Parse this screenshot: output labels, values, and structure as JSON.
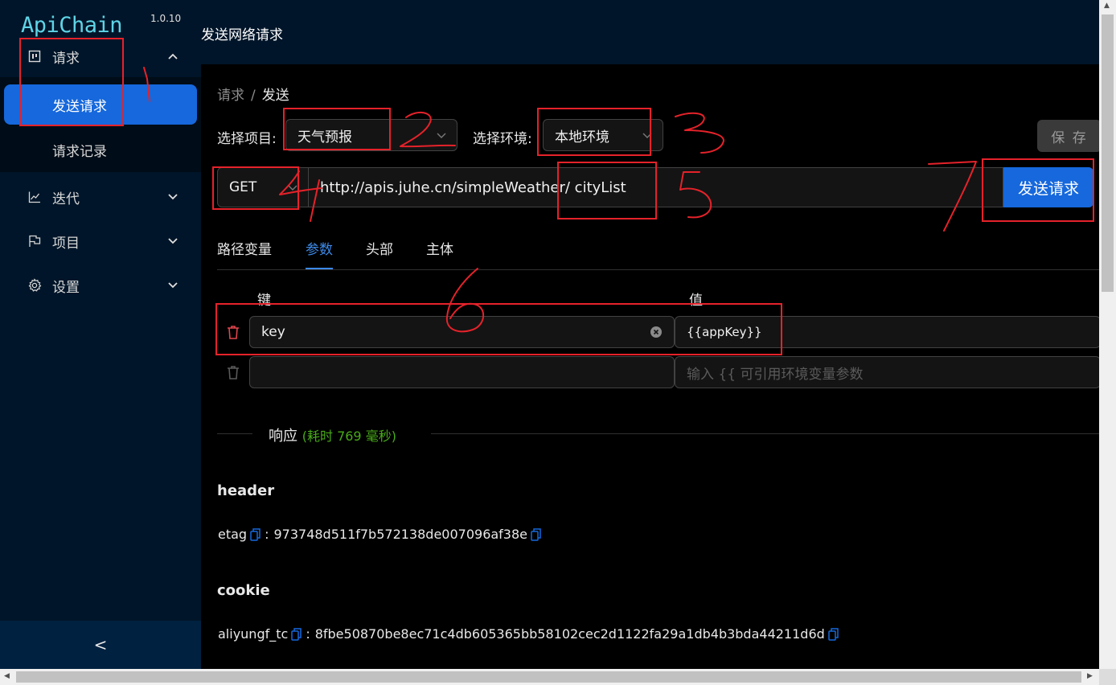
{
  "app": {
    "name": "ApiChain",
    "version": "1.0.10"
  },
  "sidebar": {
    "menu": [
      {
        "label": "请求",
        "icon": "request-icon",
        "expanded": true
      },
      {
        "label": "迭代",
        "icon": "line-chart-icon"
      },
      {
        "label": "项目",
        "icon": "project-flag-icon"
      },
      {
        "label": "设置",
        "icon": "gear-icon"
      }
    ],
    "submenu": [
      {
        "label": "发送请求",
        "active": true
      },
      {
        "label": "请求记录"
      }
    ],
    "collapse": "<"
  },
  "header": {
    "title": "发送网络请求"
  },
  "breadcrumb": {
    "parent": "请求",
    "sep": "/",
    "current": "发送"
  },
  "form": {
    "project_label": "选择项目:",
    "project_value": "天气预报",
    "env_label": "选择环境:",
    "env_value": "本地环境",
    "save_label": "保 存",
    "method": "GET",
    "url": "http://apis.juhe.cn/simpleWeather/ cityList",
    "send_label": "发送请求"
  },
  "tabs": [
    {
      "label": "路径变量"
    },
    {
      "label": "参数",
      "active": true
    },
    {
      "label": "头部"
    },
    {
      "label": "主体"
    }
  ],
  "params": {
    "key_header": "键",
    "value_header": "值",
    "rows": [
      {
        "key": "key",
        "value": "{{appKey}}"
      },
      {
        "key": "",
        "value_placeholder": "输入 {{ 可引用环境变量参数"
      }
    ]
  },
  "response": {
    "title": "响应",
    "time": "(耗时 769 毫秒)",
    "sections": [
      {
        "heading": "header",
        "key": "etag",
        "value": "973748d511f7b572138de007096af38e"
      },
      {
        "heading": "cookie",
        "key": "aliyungf_tc",
        "value": "8fbe50870be8ec71c4db605365bb58102cec2d1122fa29a1db4b3bda44211d6d"
      }
    ]
  },
  "annotations": [
    "1",
    "2",
    "3",
    "4",
    "5",
    "6",
    "7"
  ],
  "colors": {
    "primary": "#1668dc",
    "sidebar": "#001529",
    "annotation": "#e5222a",
    "success": "#49aa19"
  }
}
